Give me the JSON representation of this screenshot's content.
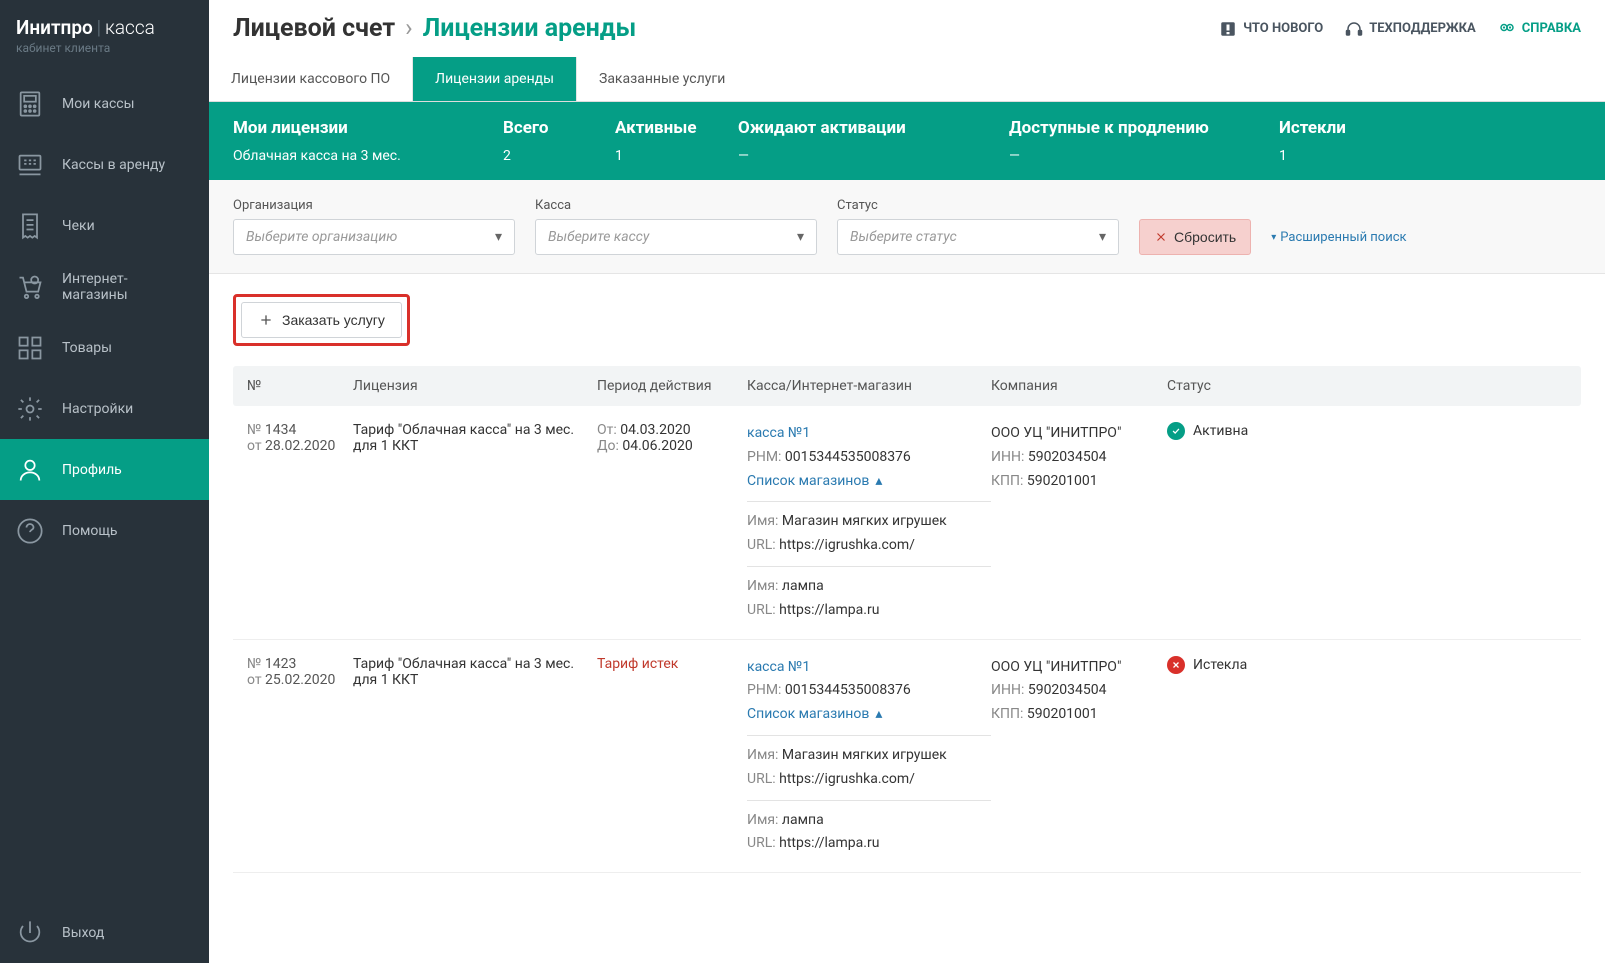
{
  "logo": {
    "brand": "Инитпро",
    "product": "касса",
    "subtitle": "кабинет клиента"
  },
  "nav": {
    "items": [
      {
        "label": "Мои кассы"
      },
      {
        "label": "Кассы в аренду"
      },
      {
        "label": "Чеки"
      },
      {
        "label": "Интернет-магазины"
      },
      {
        "label": "Товары"
      },
      {
        "label": "Настройки"
      },
      {
        "label": "Профиль"
      },
      {
        "label": "Помощь"
      }
    ],
    "exit": "Выход"
  },
  "breadcrumb": {
    "parent": "Лицевой счет",
    "current": "Лицензии аренды"
  },
  "topActions": {
    "news": "ЧТО НОВОГО",
    "support": "ТЕХПОДДЕРЖКА",
    "help": "СПРАВКА"
  },
  "tabs": [
    {
      "label": "Лицензии кассового ПО"
    },
    {
      "label": "Лицензии аренды"
    },
    {
      "label": "Заказанные услуги"
    }
  ],
  "summary": {
    "myLicensesLabel": "Мои лицензии",
    "myLicensesValue": "Облачная касса на 3 мес.",
    "totalLabel": "Всего",
    "totalValue": "2",
    "activeLabel": "Активные",
    "activeValue": "1",
    "pendingLabel": "Ожидают активации",
    "pendingValue": "—",
    "renewableLabel": "Доступные к продлению",
    "renewableValue": "—",
    "expiredLabel": "Истекли",
    "expiredValue": "1"
  },
  "filters": {
    "orgLabel": "Организация",
    "orgPlaceholder": "Выберите организацию",
    "kassaLabel": "Касса",
    "kassaPlaceholder": "Выберите кассу",
    "statusLabel": "Статус",
    "statusPlaceholder": "Выберите статус",
    "reset": "Сбросить",
    "advanced": "Расширенный поиск"
  },
  "orderButton": "Заказать услугу",
  "tableHead": {
    "num": "№",
    "lic": "Лицензия",
    "period": "Период действия",
    "kassa": "Касса/Интернет-магазин",
    "company": "Компания",
    "status": "Статус"
  },
  "rows": [
    {
      "num": "1434",
      "date": "28.02.2020",
      "lic": "Тариф \"Облачная касса\" на 3 мес. для 1 ККТ",
      "periodFrom": "04.03.2020",
      "periodTo": "04.06.2020",
      "expired": false,
      "kassaName": "касса №1",
      "rnm": "0015344535008376",
      "storesLabel": "Список магазинов",
      "stores": [
        {
          "name": "Магазин мягких игрушек",
          "url": "https://igrushka.com/"
        },
        {
          "name": "лампа",
          "url": "https://lampa.ru"
        }
      ],
      "companyName": "ООО УЦ \"ИНИТПРО\"",
      "inn": "5902034504",
      "kpp": "590201001",
      "statusText": "Активна",
      "statusOk": true
    },
    {
      "num": "1423",
      "date": "25.02.2020",
      "lic": "Тариф \"Облачная касса\" на 3 мес. для 1 ККТ",
      "expiredText": "Тариф истек",
      "expired": true,
      "kassaName": "касса №1",
      "rnm": "0015344535008376",
      "storesLabel": "Список магазинов",
      "stores": [
        {
          "name": "Магазин мягких игрушек",
          "url": "https://igrushka.com/"
        },
        {
          "name": "лампа",
          "url": "https://lampa.ru"
        }
      ],
      "companyName": "ООО УЦ \"ИНИТПРО\"",
      "inn": "5902034504",
      "kpp": "590201001",
      "statusText": "Истекла",
      "statusOk": false
    }
  ],
  "labels": {
    "numPrefix": "№",
    "datePrefix": "от",
    "from": "От:",
    "to": "До:",
    "rnm": "РНМ:",
    "name": "Имя:",
    "url": "URL:",
    "inn": "ИНН:",
    "kpp": "КПП:"
  }
}
